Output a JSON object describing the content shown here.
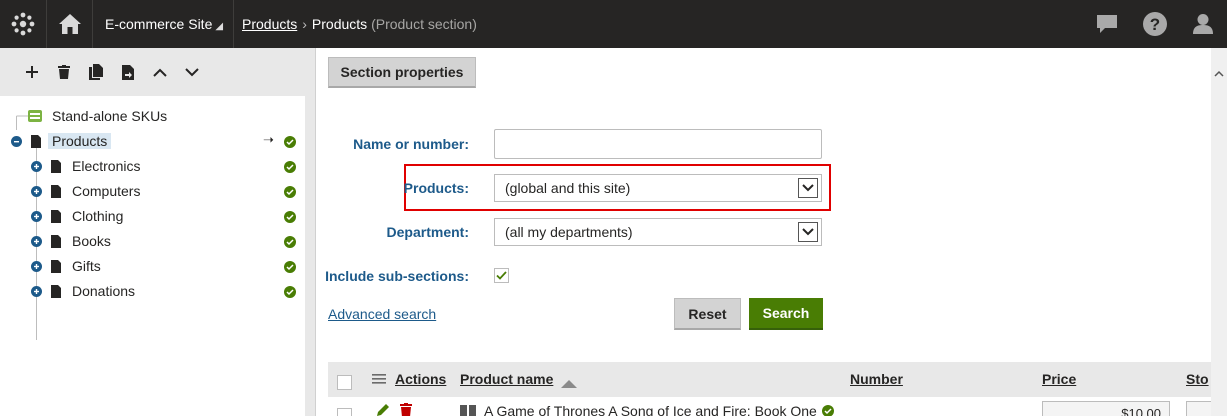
{
  "topbar": {
    "site_label": "E-commerce Site",
    "breadcrumb_link": "Products",
    "breadcrumb_current": "Products",
    "breadcrumb_detail": "(Product section)"
  },
  "tree_toolbar": {
    "buttons": [
      "add-icon",
      "delete-icon",
      "copy-icon",
      "move-icon",
      "up-icon",
      "down-icon"
    ]
  },
  "tree": {
    "root_label": "Stand-alone SKUs",
    "selected_label": "Products",
    "children": [
      "Electronics",
      "Computers",
      "Clothing",
      "Books",
      "Gifts",
      "Donations"
    ]
  },
  "content": {
    "section_properties_label": "Section properties",
    "filter": {
      "name_label": "Name or number:",
      "name_value": "",
      "products_label": "Products:",
      "products_value": "(global and this site)",
      "department_label": "Department:",
      "department_value": "(all my departments)",
      "subsections_label": "Include sub-sections:",
      "subsections_checked": true
    },
    "advanced_search_label": "Advanced search",
    "reset_label": "Reset",
    "search_label": "Search",
    "grid": {
      "col_actions": "Actions",
      "col_product_name": "Product name",
      "col_number": "Number",
      "col_price": "Price",
      "col_stock": "Sto",
      "row1_name": "A Game of Thrones A Song of Ice and Fire: Book One",
      "row1_price": "$10.00"
    }
  },
  "colors": {
    "topbar": "#262524",
    "accent_blue": "#1d5a8a",
    "green": "#497d04",
    "highlight_red": "#e00000"
  }
}
